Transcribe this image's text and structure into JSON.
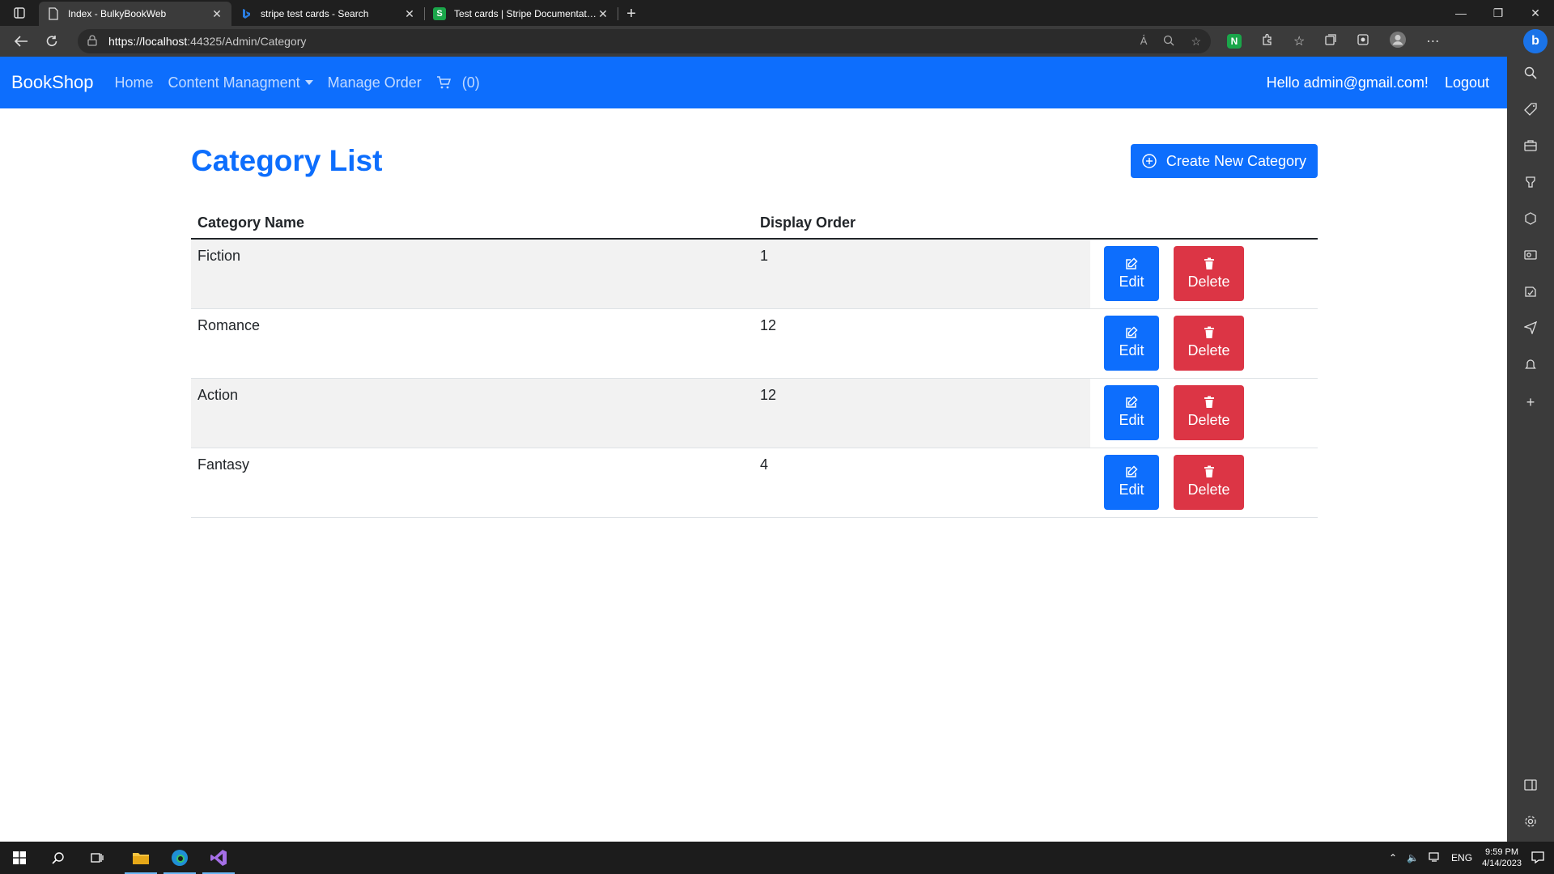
{
  "browser": {
    "tabs": [
      {
        "title": "Index - BulkyBookWeb",
        "active": true
      },
      {
        "title": "stripe test cards - Search",
        "active": false
      },
      {
        "title": "Test cards | Stripe Documentation",
        "active": false
      }
    ],
    "url_host": "https://localhost",
    "url_rest": ":44325/Admin/Category",
    "extension_badge": "N"
  },
  "navbar": {
    "brand": "BookShop",
    "links": [
      "Home",
      "Content Managment",
      "Manage Order"
    ],
    "cart_count": "(0)",
    "greeting": "Hello admin@gmail.com!",
    "logout": "Logout"
  },
  "main": {
    "title": "Category List",
    "create_button": "Create New Category",
    "columns": [
      "Category Name",
      "Display Order"
    ],
    "rows": [
      {
        "name": "Fiction",
        "order": "1"
      },
      {
        "name": "Romance",
        "order": "12"
      },
      {
        "name": "Action",
        "order": "12"
      },
      {
        "name": "Fantasy",
        "order": "4"
      }
    ],
    "edit_label": "Edit",
    "delete_label": "Delete"
  },
  "taskbar": {
    "lang": "ENG",
    "time": "9:59 PM",
    "date": "4/14/2023"
  },
  "colors": {
    "primary": "#0d6efd",
    "danger": "#dc3545",
    "chrome": "#3b3b3b"
  }
}
